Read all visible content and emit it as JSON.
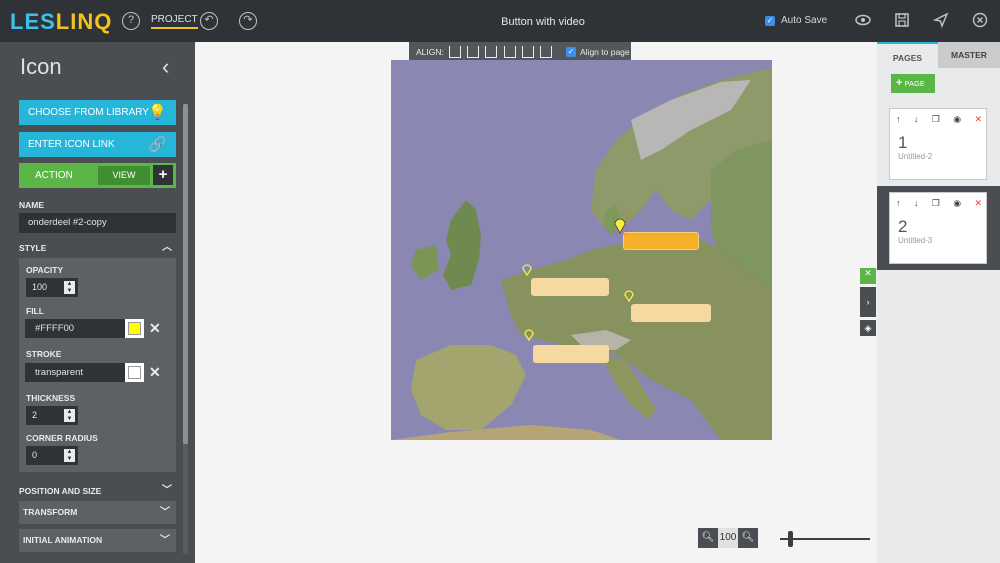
{
  "brand": {
    "logo_part1": "LES",
    "logo_part2": "LINQ",
    "color_cyan": "#3fc1e6",
    "color_yellow": "#f3c21b"
  },
  "topbar": {
    "project_label": "PROJECT",
    "document_title": "Button with video",
    "autosave_label": "Auto Save",
    "autosave_checked": true,
    "icons": [
      "help-icon",
      "undo-icon",
      "redo-icon",
      "preview-eye-icon",
      "save-icon",
      "publish-send-icon",
      "close-icon"
    ]
  },
  "left_panel": {
    "title": "Icon",
    "choose_library": "CHOOSE FROM LIBRARY",
    "enter_link": "ENTER ICON LINK",
    "action_label": "ACTION",
    "action_value": "VIEW",
    "action_add": "+",
    "name_label": "NAME",
    "name_value": "onderdeel #2-copy",
    "style_label": "STYLE",
    "opacity_label": "OPACITY",
    "opacity_value": "100",
    "fill_label": "FILL",
    "fill_value": "#FFFF00",
    "fill_color": "#FFFF00",
    "stroke_label": "STROKE",
    "stroke_value": "transparent",
    "thickness_label": "THICKNESS",
    "thickness_value": "2",
    "corner_label": "CORNER RADIUS",
    "corner_value": "0",
    "position_label": "POSITION AND SIZE",
    "transform_label": "TRANSFORM",
    "animation_label": "INITIAL ANIMATION"
  },
  "canvas": {
    "align_label": "ALIGN:",
    "align_to_page": "Align to page",
    "align_to_page_checked": true,
    "map_sea_color": "#8b87b3",
    "zoom_value": "100",
    "zoom_out": "−",
    "zoom_in": "+"
  },
  "right_panel": {
    "tab_pages": "PAGES",
    "tab_master": "MASTER",
    "add_page": "PAGE",
    "pages": [
      {
        "number": "1",
        "name": "Untitled-2"
      },
      {
        "number": "2",
        "name": "Untitled-3"
      }
    ]
  }
}
